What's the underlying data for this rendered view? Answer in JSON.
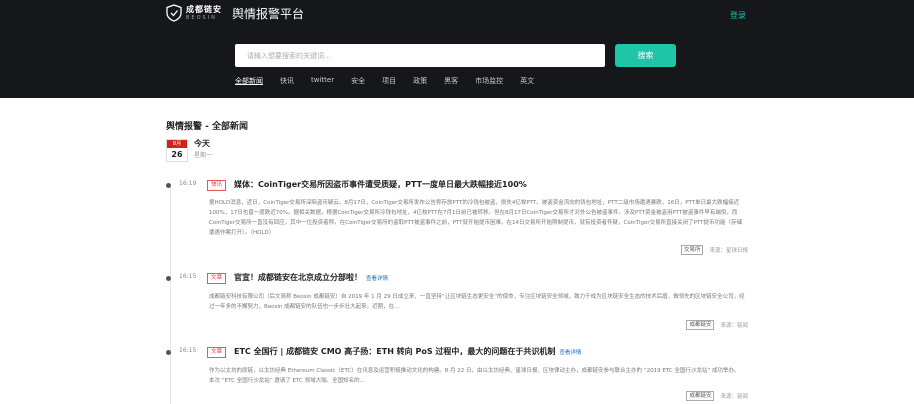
{
  "header": {
    "brand_cn": "成都链安",
    "brand_en": "BEOSIN",
    "platform_title": "舆情报警平台",
    "login_label": "登录",
    "search_placeholder": "请输入想要搜索的关键词...",
    "search_button": "搜索",
    "nav": [
      {
        "label": "全部新闻",
        "active": true
      },
      {
        "label": "快讯"
      },
      {
        "label": "twitter"
      },
      {
        "label": "安全"
      },
      {
        "label": "项目"
      },
      {
        "label": "政策"
      },
      {
        "label": "黑客"
      },
      {
        "label": "市场监控"
      },
      {
        "label": "英文"
      }
    ]
  },
  "page_heading": "舆情报警 - 全部新闻",
  "calendar": {
    "month": "8月",
    "day": "26",
    "today": "今天",
    "weekday": "星期一"
  },
  "items": [
    {
      "time": "16:19",
      "tag": "快讯",
      "title": "媒体：CoinTiger交易所因盗币事件遭受质疑，PTT一度单日最大跌幅接近100%",
      "detail_link": "",
      "summary": "据HOLD消息，近日，CoinTiger交易所深陷盗币疑云。8月17日，CoinTiger交易所发布公告称存放PTT的冷钱包被盗，损失4亿枚PTT。被盗资金流向的钱包地址，PTT二级市场遭遇暴跌，16日，PTT单日最大跌幅接近100%，17日也曾一度跌近70%。据相关数据，根据CoinTiger交易所冷钱包地址，4亿枚PTT在7月1日前已被转移。但在8月17日CoinTiger交易所才对外公告被盗事件。涉及PTT资金被盗用PTT被盗事件早有端倪，而CoinTiger交易所一直没有回应，其中一位投资者称，在CoinTiger交易所的盗取PTT被盗事件之前，PTT就开始提币困难，在14日交易所开始限制提币，就有投资者怀疑，CoinTiger交易所直接关闭了PTT提币功能（存储遭遇作案打开）。（HOLD）",
      "source_tag": "交易所",
      "source": "来源：星球日报"
    },
    {
      "time": "16:15",
      "tag": "文章",
      "title": "官宣！成都链安在北京成立分部啦！",
      "detail_link": "查看详情",
      "summary": "成都链安科技有限公司（后文简称 Beosin 成都链安）自 2019 年 1 月 29 日成立来，一直坚持“让区块链生态更安全”的使命，专注区块链安全领域，致力于成为区块链安全生态的技术后盾，做领先的区块链安全公司，经过一年多的不懈努力，Beosin 成都链安的队伍也一步步壮大起来。近期，在...",
      "source_tag": "成都链安",
      "source": "来源：链闻"
    },
    {
      "time": "16:15",
      "tag": "文章",
      "title": "ETC 全国行 | 成都链安 CMO 高子扬：ETH 转向 PoS 过程中，最大的问题在于共识机制",
      "detail_link": "查看详情",
      "summary": "作为以太坊的原链，以太坊经典 Ethereum Classic（ETC）在讯息及运营积极推动文化的构建。8 月 22 日，由以太坊经典、星球日报、区块律动主办，成都链安参与联合主办的 “2019 ETC 全国行沙龙站” 成功举办。本次 “ETC 全国行沙龙站” 邀请了 ETC 领域大咖、全国知名的...",
      "source_tag": "成都链安",
      "source": "来源：链闻"
    }
  ]
}
